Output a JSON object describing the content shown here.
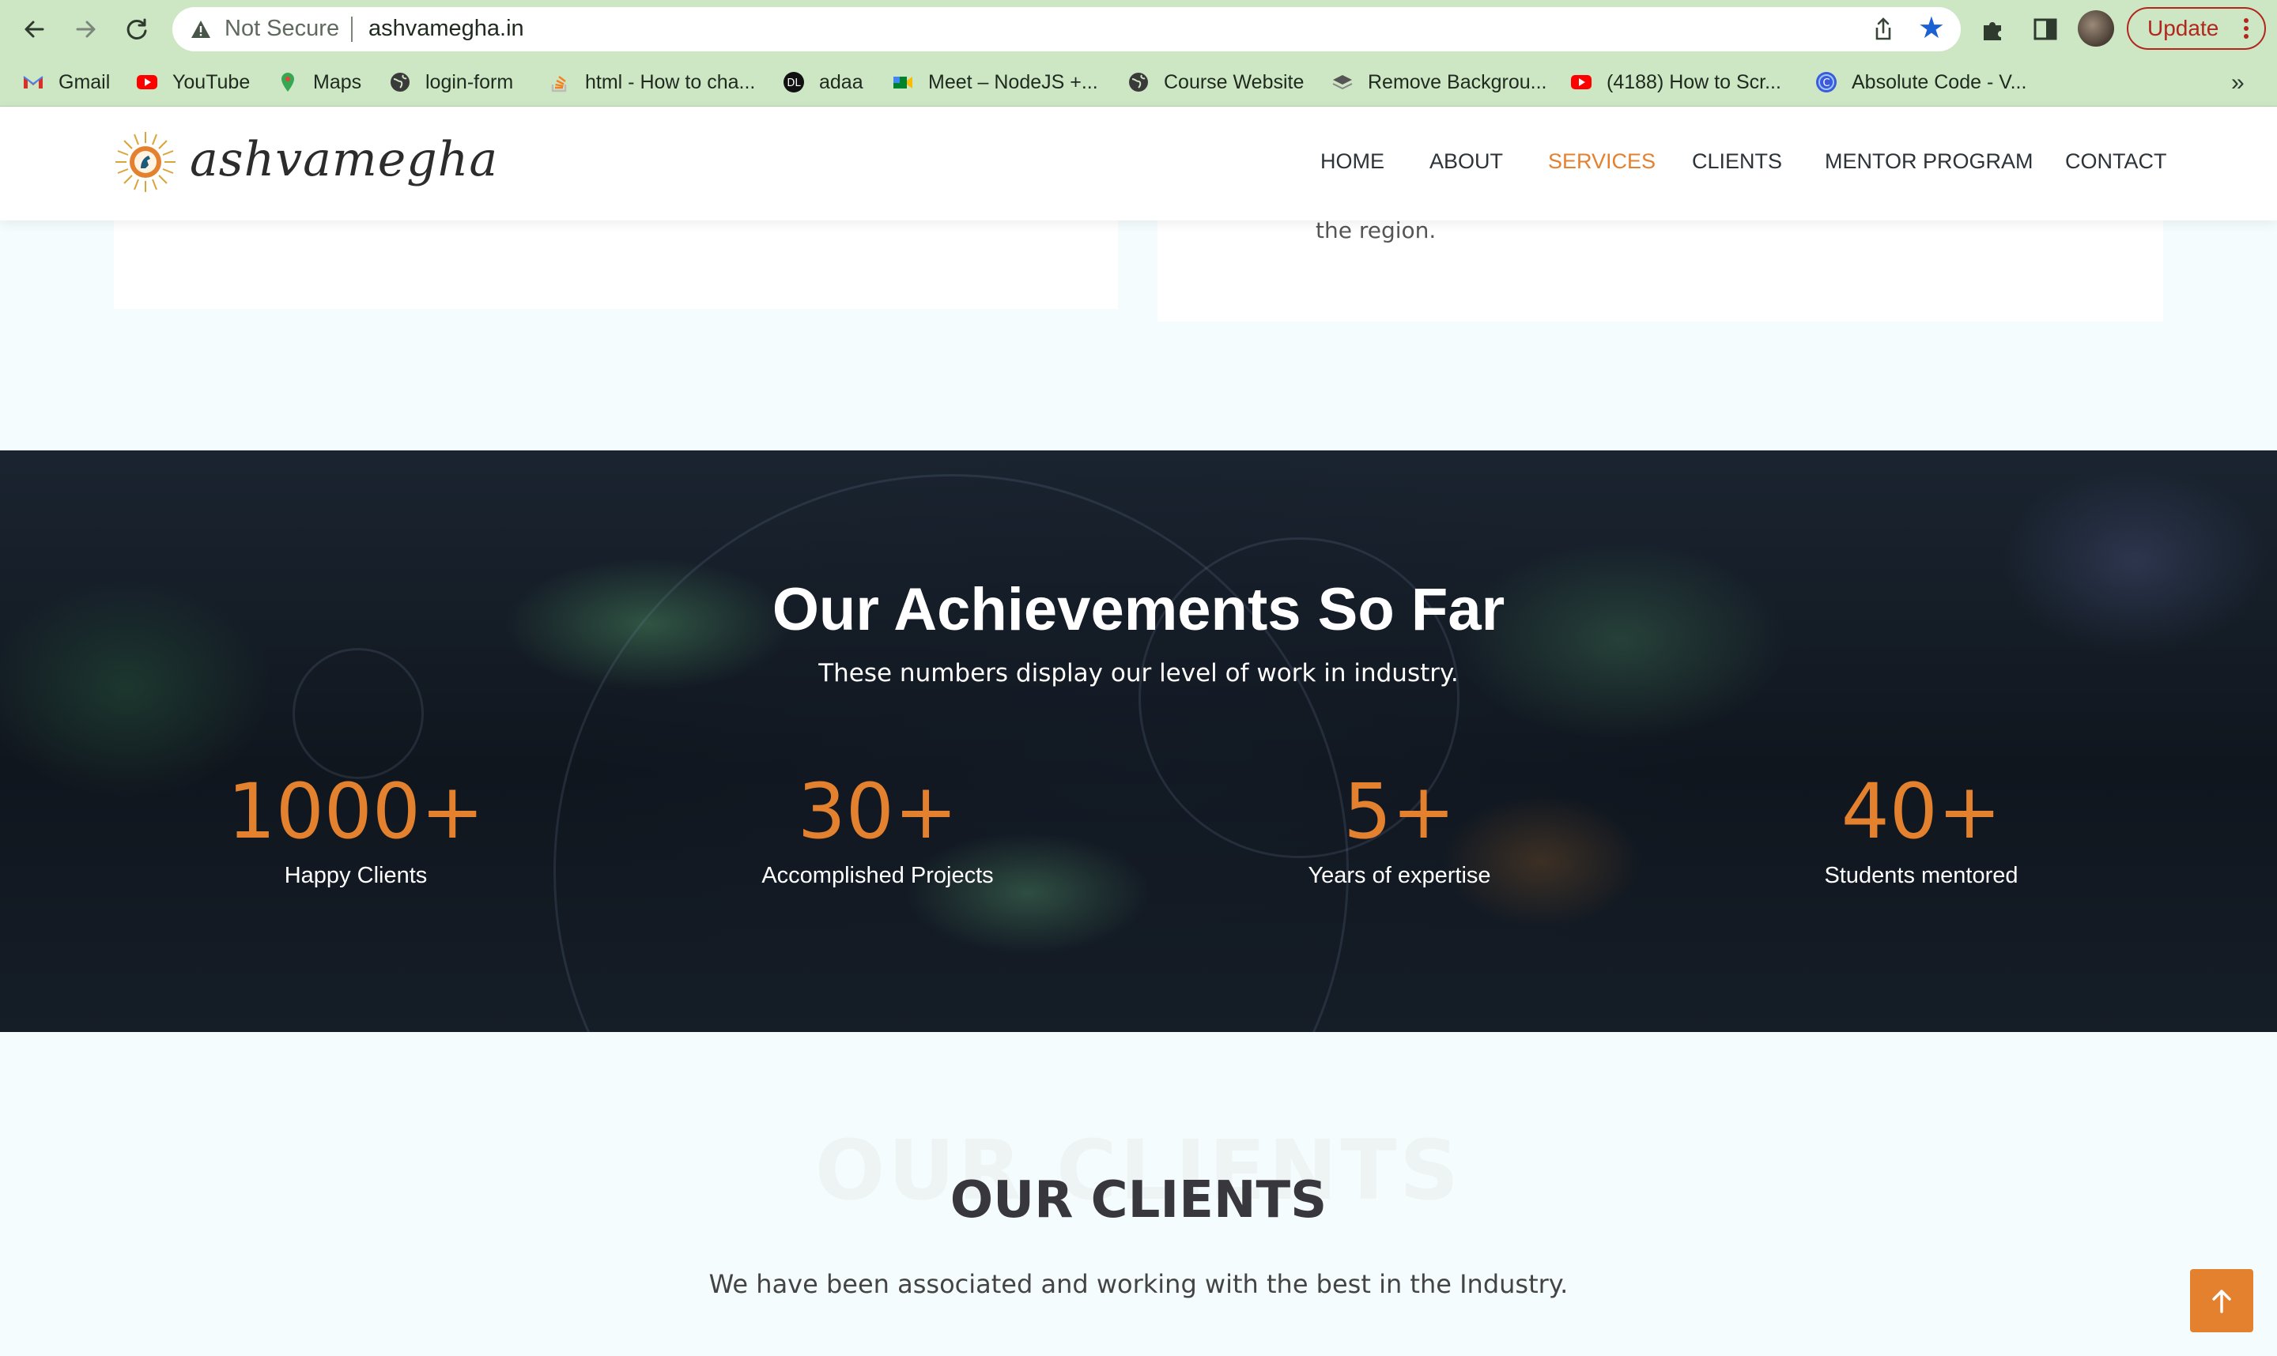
{
  "browser": {
    "security_label": "Not Secure",
    "url": "ashvamegha.in",
    "update_label": "Update",
    "bookmarks": [
      {
        "label": "Gmail",
        "icon": "gmail-icon"
      },
      {
        "label": "YouTube",
        "icon": "youtube-icon"
      },
      {
        "label": "Maps",
        "icon": "maps-icon"
      },
      {
        "label": "login-form",
        "icon": "globe-icon"
      },
      {
        "label": "html - How to cha...",
        "icon": "stackoverflow-icon"
      },
      {
        "label": "adaa",
        "icon": "adaa-icon"
      },
      {
        "label": "Meet – NodeJS +...",
        "icon": "meet-icon"
      },
      {
        "label": "Course Website",
        "icon": "globe-icon"
      },
      {
        "label": "Remove Backgrou...",
        "icon": "layers-icon"
      },
      {
        "label": "(4188) How to Scr...",
        "icon": "youtube-icon"
      },
      {
        "label": "Absolute Code - V...",
        "icon": "absolute-code-icon"
      }
    ],
    "more_label": "»"
  },
  "site": {
    "logo_text": "ashvamegha",
    "nav": [
      {
        "label": "HOME",
        "active": false
      },
      {
        "label": "ABOUT",
        "active": false
      },
      {
        "label": "SERVICES",
        "active": true
      },
      {
        "label": "CLIENTS",
        "active": false
      },
      {
        "label": "MENTOR PROGRAM",
        "active": false
      },
      {
        "label": "CONTACT",
        "active": false
      }
    ],
    "accent_color": "#e4812f"
  },
  "services_card_tail": "the region.",
  "achievements": {
    "title": "Our Achievements So Far",
    "subtitle": "These numbers display our level of work in industry.",
    "stats": [
      {
        "value": "1000+",
        "label": "Happy Clients"
      },
      {
        "value": "30+",
        "label": "Accomplished Projects"
      },
      {
        "value": "5+",
        "label": "Years of expertise"
      },
      {
        "value": "40+",
        "label": "Students mentored"
      }
    ]
  },
  "clients": {
    "background_title": "OUR CLIENTS",
    "title": "OUR CLIENTS",
    "subtitle": "We have been associated and working with the best in the Industry."
  }
}
